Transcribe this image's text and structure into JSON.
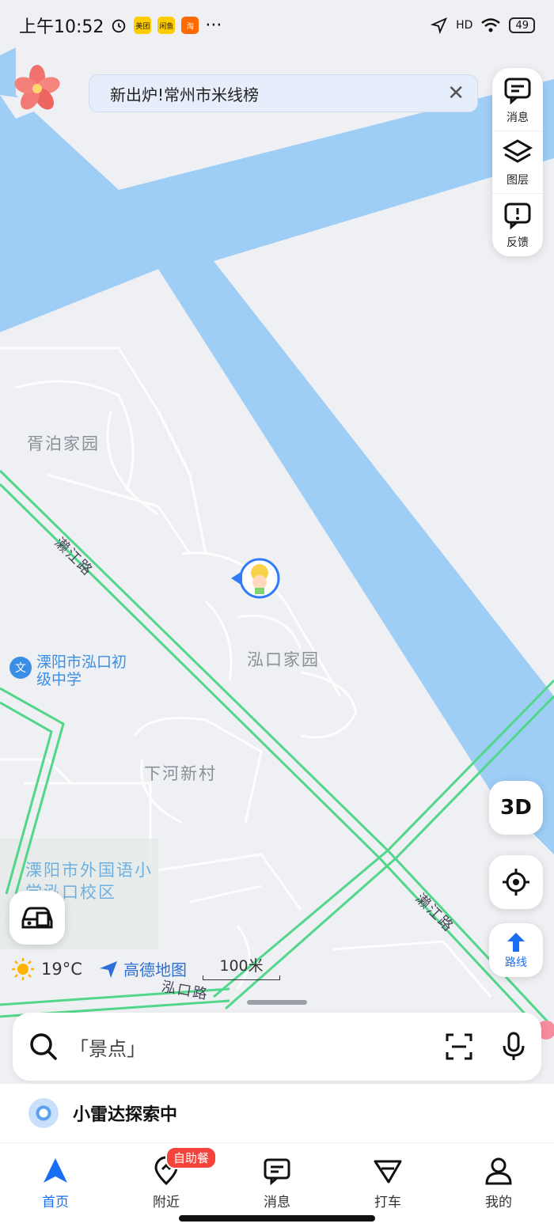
{
  "status_bar": {
    "time": "上午10:52",
    "apps": [
      "美团",
      "闲鱼",
      "淘"
    ],
    "more": "···",
    "signal": "HD",
    "battery": "49"
  },
  "banner": {
    "text": "新出炉!常州市米线榜",
    "close": "✕"
  },
  "side_tools": [
    {
      "label": "消息",
      "icon": "message-icon"
    },
    {
      "label": "图层",
      "icon": "layers-icon"
    },
    {
      "label": "反馈",
      "icon": "feedback-icon"
    }
  ],
  "map": {
    "pois": [
      "胥泊家园",
      "泓口家园",
      "下河新村"
    ],
    "school_badge": "文",
    "school_1": "溧阳市泓口初级中学",
    "school_2": "溧阳市外国语小学泓口校区",
    "roads": [
      "濑江路",
      "濑江路",
      "泓口路"
    ],
    "colors": {
      "water": "#9ecdf6",
      "road": "#52d68a",
      "land": "#eef0f3"
    }
  },
  "controls": {
    "three_d": "3D",
    "route": "路线"
  },
  "weather": {
    "temp": "19°C",
    "icon": "sun-icon"
  },
  "brand": "高德地图",
  "scale": "100米",
  "search": {
    "placeholder": "「景点」"
  },
  "radar": {
    "text": "小雷达探索中"
  },
  "tabs": [
    {
      "label": "首页",
      "icon": "navigate-icon",
      "active": true
    },
    {
      "label": "附近",
      "icon": "nearby-icon",
      "badge": "自助餐"
    },
    {
      "label": "消息",
      "icon": "message-icon"
    },
    {
      "label": "打车",
      "icon": "taxi-icon"
    },
    {
      "label": "我的",
      "icon": "user-icon"
    }
  ]
}
